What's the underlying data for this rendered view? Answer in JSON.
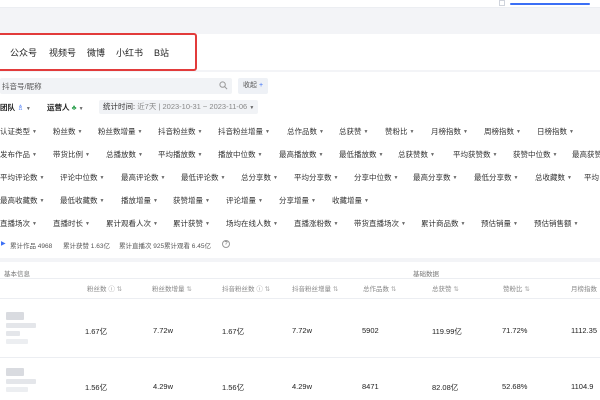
{
  "platform_tabs": [
    "公众号",
    "视频号",
    "微博",
    "小红书",
    "B站"
  ],
  "search": {
    "placeholder": "抖音号/昵称",
    "collect_label": "收起",
    "collect_icon": "+"
  },
  "team_filter": {
    "team_label": "团队",
    "operator_label": "运营人"
  },
  "stat_time": {
    "label": "统计时间:",
    "preset": "近7天",
    "range": "2023-10-31 ~ 2023-11-06"
  },
  "filter_rows": [
    [
      "认证类型",
      "粉丝数",
      "粉丝数增量",
      "抖音粉丝数",
      "抖音粉丝增量",
      "总作品数",
      "总获赞",
      "赞粉比",
      "月榜指数",
      "周榜指数",
      "日榜指数"
    ],
    [
      "发布作品",
      "带货比例",
      "总播放数",
      "平均播放数",
      "播放中位数",
      "最高播放数",
      "最低播放数",
      "总获赞数",
      "平均获赞数",
      "获赞中位数",
      "最高获赞"
    ],
    [
      "平均评论数",
      "评论中位数",
      "最高评论数",
      "最低评论数",
      "总分享数",
      "平均分享数",
      "分享中位数",
      "最高分享数",
      "最低分享数",
      "总收藏数",
      "平均"
    ],
    [
      "最高收藏数",
      "最低收藏数",
      "播放增量",
      "获赞增量",
      "评论增量",
      "分享增量",
      "收藏增量"
    ],
    [
      "直播场次",
      "直播时长",
      "累计观看人次",
      "累计获赞",
      "场均在线人数",
      "直播涨粉数",
      "带货直播场次",
      "累计商品数",
      "预估销量",
      "预估销售额"
    ]
  ],
  "summary": {
    "works": "累计作品 4968",
    "likes": "累计获赞 1.63亿",
    "live": "累计直播次 925",
    "views": "累计观看 6.45亿",
    "help_icon": "?"
  },
  "table": {
    "group_basic": "基本信息",
    "group_base_data": "基础数据",
    "columns": [
      "粉丝数",
      "粉丝数增量",
      "抖音粉丝数",
      "抖音粉丝增量",
      "总作品数",
      "总获赞",
      "赞粉比",
      "月榜指数"
    ],
    "rows": [
      [
        "1.67亿",
        "7.72w",
        "1.67亿",
        "7.72w",
        "5902",
        "119.99亿",
        "71.72%",
        "1112.35"
      ],
      [
        "1.56亿",
        "4.29w",
        "1.56亿",
        "4.29w",
        "8471",
        "82.08亿",
        "52.68%",
        "1104.9"
      ]
    ]
  },
  "colors": {
    "accent": "#3b6ff5",
    "highlight_box": "#e23b3b",
    "operator_icon": "#3aa65a"
  }
}
